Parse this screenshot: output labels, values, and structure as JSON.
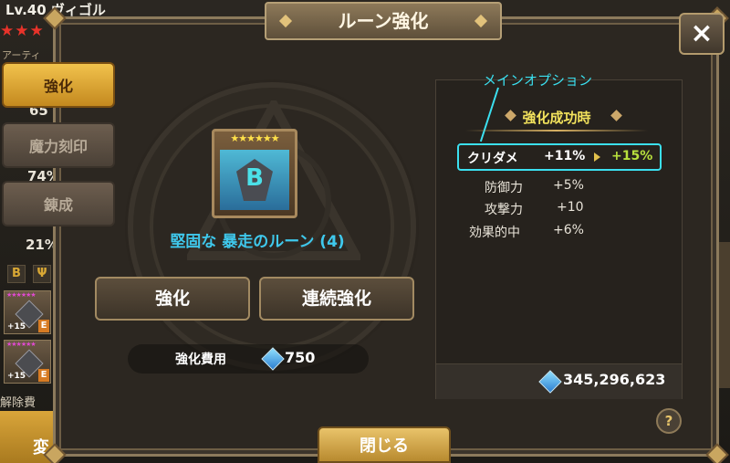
{
  "background": {
    "level_name": "Lv.40 ヴィゴル",
    "stars": "★★★",
    "sub_label": "アーティ",
    "numbers": [
      "65",
      "74%",
      "21%"
    ],
    "unlock_text": "解除費",
    "bottom_button": "変"
  },
  "tabs": [
    {
      "label": "強化",
      "active": true
    },
    {
      "label": "魔力刻印",
      "active": false
    },
    {
      "label": "錬成",
      "active": false
    }
  ],
  "dialog": {
    "title": "ルーン強化",
    "close_icon": "×"
  },
  "rune": {
    "stars": "★★★★★★",
    "glyph": "B",
    "name": "堅固な 暴走のルーン (4)"
  },
  "buttons": {
    "upgrade": "強化",
    "continuous_upgrade": "連続強化",
    "close": "閉じる"
  },
  "cost": {
    "label": "強化費用",
    "value": "750"
  },
  "result_panel": {
    "main_option_callout": "メインオプション",
    "success_title": "強化成功時",
    "main_stat": {
      "name": "クリダメ",
      "current": "+11%",
      "next": "+15%"
    },
    "sub_stats": [
      {
        "name": "防御力",
        "value": "+5%"
      },
      {
        "name": "攻撃力",
        "value": "+10"
      },
      {
        "name": "効果的中",
        "value": "+6%"
      }
    ],
    "total_currency": "345,296,623"
  },
  "help_label": "?",
  "colors": {
    "accent_cyan": "#3be0f0",
    "rune_name": "#3fc8ec",
    "success_yellow": "#f2e25c",
    "next_value_green": "#b8e03d",
    "tab_active": "#f1c24c"
  }
}
